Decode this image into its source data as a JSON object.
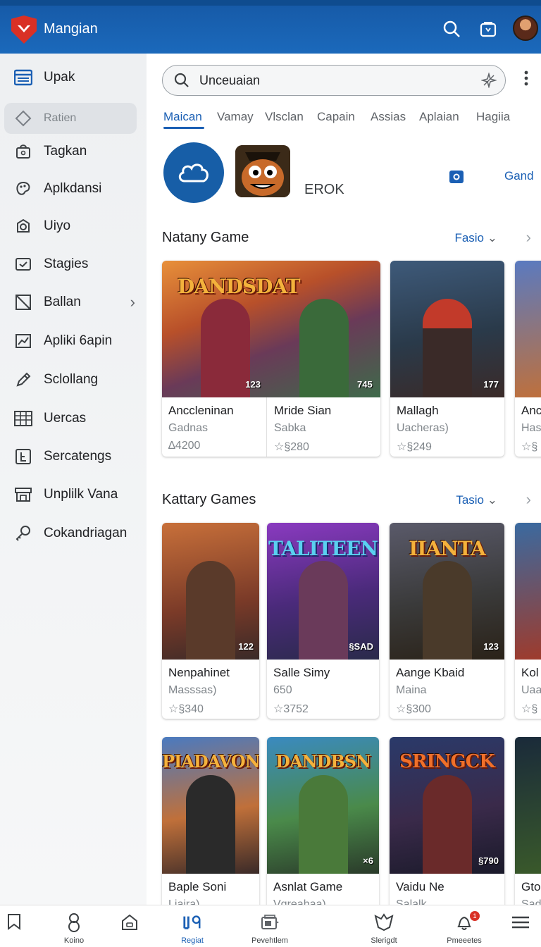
{
  "app": {
    "title": "Mangian"
  },
  "colors": {
    "primary": "#1b69bb",
    "accent": "#1a5fb4",
    "sidebar_bg": "#eef0f2",
    "logo": "#d93025"
  },
  "topbar": {
    "icons": [
      "search-icon",
      "bag-icon"
    ]
  },
  "sidebar": {
    "items": [
      {
        "label": "Upak",
        "icon": "window-icon"
      },
      {
        "label": "Ratien",
        "icon": "diamond-icon"
      },
      {
        "label": "Tagkan",
        "icon": "bag-icon"
      },
      {
        "label": "Aplkdansi",
        "icon": "palette-icon"
      },
      {
        "label": "Uiyo",
        "icon": "target-icon"
      },
      {
        "label": "Stagies",
        "icon": "checkbox-icon"
      },
      {
        "label": "Ballan",
        "icon": "slash-square-icon"
      },
      {
        "label": "Apliki 6apin",
        "icon": "chart-icon"
      },
      {
        "label": "Sclollang",
        "icon": "pencil-icon"
      },
      {
        "label": "Uercas",
        "icon": "grid-icon"
      },
      {
        "label": "Sercatengs",
        "icon": "e-box-icon"
      },
      {
        "label": "Unplilk Vana",
        "icon": "store-icon"
      },
      {
        "label": "Cokandriagan",
        "icon": "key-icon"
      }
    ]
  },
  "search": {
    "value": "Unceuaian"
  },
  "tabs": [
    "Maican",
    "Vamay",
    "Vlsclan",
    "Capain",
    "Assias",
    "Aplaian",
    "Hagiia"
  ],
  "feature": {
    "label": "EROK",
    "link": "Gand"
  },
  "sections": [
    {
      "title": "Natany Game",
      "filter": "Fasio",
      "cards": [
        {
          "art_title": "DANDSDAT",
          "title": "Anccleninan",
          "sub": "Gadnas",
          "rating": "∆4200",
          "badge": "123",
          "title2": "Mride Sian",
          "sub2": "Sabka",
          "rating2": "☆§280",
          "badge2": "745"
        },
        {
          "art_title": "",
          "title": "Mallagh",
          "sub": "Uacheras)",
          "rating": "☆§249",
          "badge": "177"
        },
        {
          "art_title": "",
          "title": "Anc",
          "sub": "Has",
          "rating": "☆§",
          "badge": ""
        }
      ]
    },
    {
      "title": "Kattary Games",
      "filter": "Tasio",
      "cards": [
        {
          "art_title": "",
          "title": "Nenpahinet",
          "sub": "Masssas)",
          "rating": "☆§340",
          "badge": "122"
        },
        {
          "art_title": "TALITEEN",
          "title": "Salle Simy",
          "sub": "650",
          "rating": "☆3752",
          "badge": "§SAD"
        },
        {
          "art_title": "IIANTA",
          "title": "Aange Kbaid",
          "sub": "Maina",
          "rating": "☆§300",
          "badge": "123"
        },
        {
          "art_title": "",
          "title": "Kol",
          "sub": "Uaa",
          "rating": "☆§",
          "badge": ""
        }
      ]
    },
    {
      "title": "",
      "cards": [
        {
          "art_title": "PIADAVON",
          "title": "Baple Soni",
          "sub": "Ljaira)",
          "rating": "",
          "badge": ""
        },
        {
          "art_title": "DANDBSN",
          "title": "Asnlat Game",
          "sub": "Vgreahaa)",
          "rating": "",
          "badge": "×6"
        },
        {
          "art_title": "SRINGCK",
          "title": "Vaidu Ne",
          "sub": "Salalk",
          "rating": "",
          "badge": "§790"
        },
        {
          "art_title": "",
          "title": "Gto",
          "sub": "Sad",
          "rating": "",
          "badge": ""
        }
      ]
    }
  ],
  "bottom_nav": [
    {
      "label": "",
      "icon": "bookmark-icon"
    },
    {
      "label": "Koino",
      "icon": "person-icon"
    },
    {
      "label": "",
      "icon": "home-icon"
    },
    {
      "label": "Regiat",
      "icon": "games-icon",
      "active": true
    },
    {
      "label": "Pevehtlem",
      "icon": "library-icon"
    },
    {
      "label": "Slerigdt",
      "icon": "shield-icon"
    },
    {
      "label": "Pmeeetes",
      "icon": "bell-icon",
      "badge": "1"
    },
    {
      "label": "",
      "icon": "menu-icon"
    }
  ]
}
